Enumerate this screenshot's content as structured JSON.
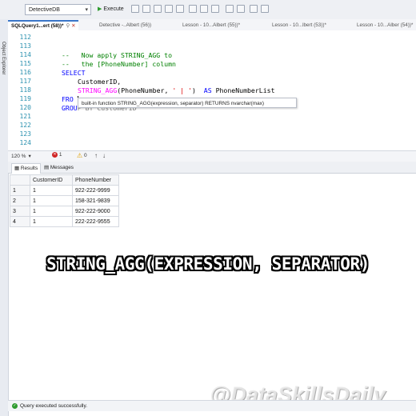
{
  "toolbar": {
    "database": "DetectiveDB",
    "execute_label": "Execute"
  },
  "side_panel": {
    "label": "Object Explorer"
  },
  "tabs": [
    {
      "label": "SQLQuery1...ert (58))*",
      "active": true
    },
    {
      "label": "Detective -..Albert (56))",
      "active": false
    },
    {
      "label": "Lesson - 10...Albert (55))*",
      "active": false
    },
    {
      "label": "Lesson - 10...lbert (53))*",
      "active": false
    },
    {
      "label": "Lesson - 10...Alber (54))*",
      "active": false
    }
  ],
  "editor": {
    "line_numbers": [
      "112",
      "113",
      "114",
      "115",
      "116",
      "117",
      "118",
      "119",
      "120",
      "121",
      "122",
      "123",
      "124"
    ],
    "comment1": "--   Now apply STRING_AGG to",
    "comment2": "--   the [PhoneNumber] column",
    "select_kw": "SELECT",
    "customer_col": "CustomerID,",
    "fn_name": "STRING_AGG",
    "fn_args_open": "(PhoneNumber, ",
    "fn_sep": "' | '",
    "fn_args_close": ")",
    "as_kw": "AS",
    "alias": "PhoneNumberList",
    "from_partial": "FRO",
    "group_partial": "GROU",
    "group_tail": "P BY CustomerID",
    "tooltip": "built-in function STRING_AGG(expression, separator) RETURNS nvarchar(max)"
  },
  "editor_status": {
    "zoom": "120 %",
    "errors": "1",
    "warnings": "0"
  },
  "results_tabs": [
    {
      "label": "Results",
      "active": true
    },
    {
      "label": "Messages",
      "active": false
    }
  ],
  "grid": {
    "headers": [
      "CustomerID",
      "PhoneNumber"
    ],
    "rows": [
      {
        "n": "1",
        "customer": "1",
        "phone": "922-222-9999"
      },
      {
        "n": "2",
        "customer": "1",
        "phone": "158-321-9839"
      },
      {
        "n": "3",
        "customer": "1",
        "phone": "922-222-9000"
      },
      {
        "n": "4",
        "customer": "1",
        "phone": "222-222-9555"
      }
    ]
  },
  "caption": "STRING_AGG(EXPRESSION, SEPARATOR)",
  "watermark": "@DataSkillsDaily",
  "status_bar": {
    "message": "Query executed successfully."
  },
  "colors": {
    "keyword": "#0000ff",
    "comment": "#008000",
    "function": "#ff00ff",
    "string": "#dd0000",
    "line_number": "#2b91af",
    "active_tab_accent": "#3a76c8"
  }
}
